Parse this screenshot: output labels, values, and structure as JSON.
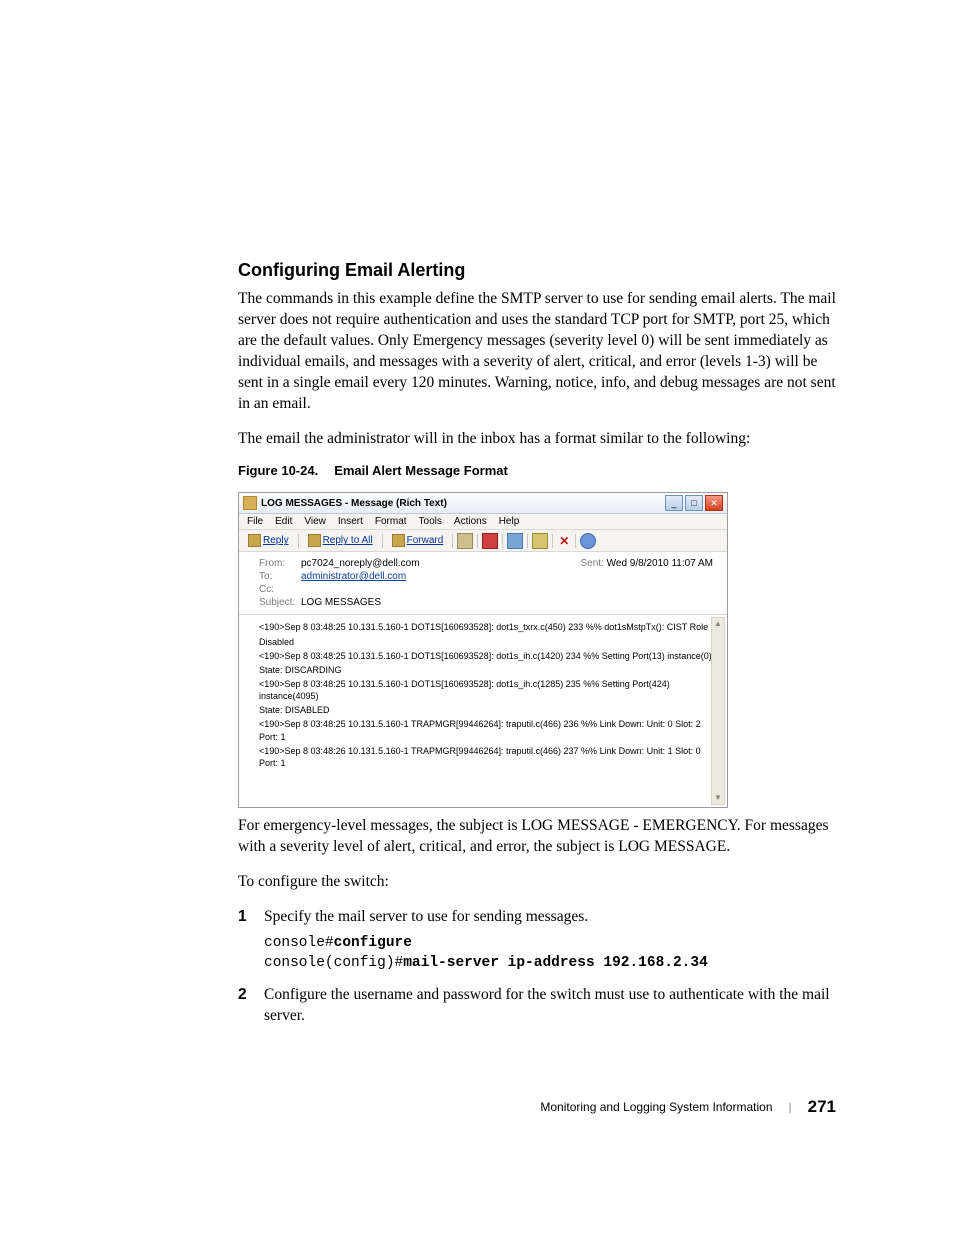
{
  "heading": "Configuring Email Alerting",
  "para1": "The commands in this example define the SMTP server to use for sending email alerts. The mail server does not require authentication and uses the standard TCP port for SMTP, port 25, which are the default values. Only Emergency messages (severity level 0) will be sent immediately as individual emails, and messages with a severity of alert, critical, and error (levels 1-3) will be sent in a single email every 120 minutes. Warning, notice, info, and debug messages are not sent in an email.",
  "para2": "The email the administrator will in the inbox has a format similar to the following:",
  "figure": {
    "num": "Figure 10-24.",
    "title": "Email Alert Message Format"
  },
  "email": {
    "windowTitle": "LOG MESSAGES - Message (Rich Text)",
    "menus": [
      "File",
      "Edit",
      "View",
      "Insert",
      "Format",
      "Tools",
      "Actions",
      "Help"
    ],
    "toolbar": {
      "reply": "Reply",
      "replyAll": "Reply to All",
      "forward": "Forward"
    },
    "header": {
      "fromLabel": "From:",
      "from": "pc7024_noreply@dell.com",
      "toLabel": "To:",
      "to": "administrator@dell.com",
      "ccLabel": "Cc:",
      "cc": "",
      "subjectLabel": "Subject:",
      "subject": "LOG MESSAGES",
      "sentLabel": "Sent:",
      "sent": "Wed 9/8/2010 11:07 AM"
    },
    "body": [
      "<190>Sep  8 03:48:25     10.131.5.160-1 DOT1S[160693528]: dot1s_txrx.c(450) 233 %% dot1sMstpTx(): CIST Role",
      "Disabled",
      "<190>Sep  8 03:48:25     10.131.5.160-1 DOT1S[160693528]: dot1s_ih.c(1420) 234 %% Setting Port(13) instance(0)",
      "State: DISCARDING",
      "<190>Sep  8 03:48:25     10.131.5.160-1 DOT1S[160693528]: dot1s_ih.c(1285) 235 %% Setting Port(424) instance(4095)",
      "State: DISABLED",
      "<190>Sep  8 03:48:25     10.131.5.160-1 TRAPMGR[99446264]: traputil.c(466) 236 %% Link Down: Unit: 0 Slot: 2 Port: 1",
      "<190>Sep  8 03:48:26     10.131.5.160-1 TRAPMGR[99446264]: traputil.c(466) 237 %% Link Down: Unit: 1 Slot: 0 Port: 1"
    ]
  },
  "para3": "For emergency-level messages, the subject is LOG MESSAGE - EMERGENCY. For messages with a severity level of alert, critical, and error, the subject is LOG MESSAGE.",
  "para4": "To configure the switch:",
  "steps": [
    {
      "num": "1",
      "text": "Specify the mail server to use for sending messages.",
      "code": [
        {
          "pre": "console#",
          "bold": "configure"
        },
        {
          "pre": "console(config)#",
          "bold": "mail-server ip-address 192.168.2.34"
        }
      ]
    },
    {
      "num": "2",
      "text": "Configure the username and password for the switch must use to authenticate with the mail server."
    }
  ],
  "footer": {
    "chapter": "Monitoring and Logging System Information",
    "page": "271"
  }
}
